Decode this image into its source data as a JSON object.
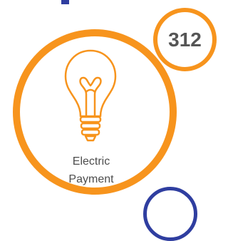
{
  "card": {
    "label_line1": "Electric",
    "label_line2": "Payment",
    "icon": "lightbulb-icon",
    "badge_value": "312"
  },
  "colors": {
    "accent": "#f7941d",
    "secondary": "#2f3ea0",
    "text": "#4d4d4d",
    "badge_text": "#555555"
  }
}
